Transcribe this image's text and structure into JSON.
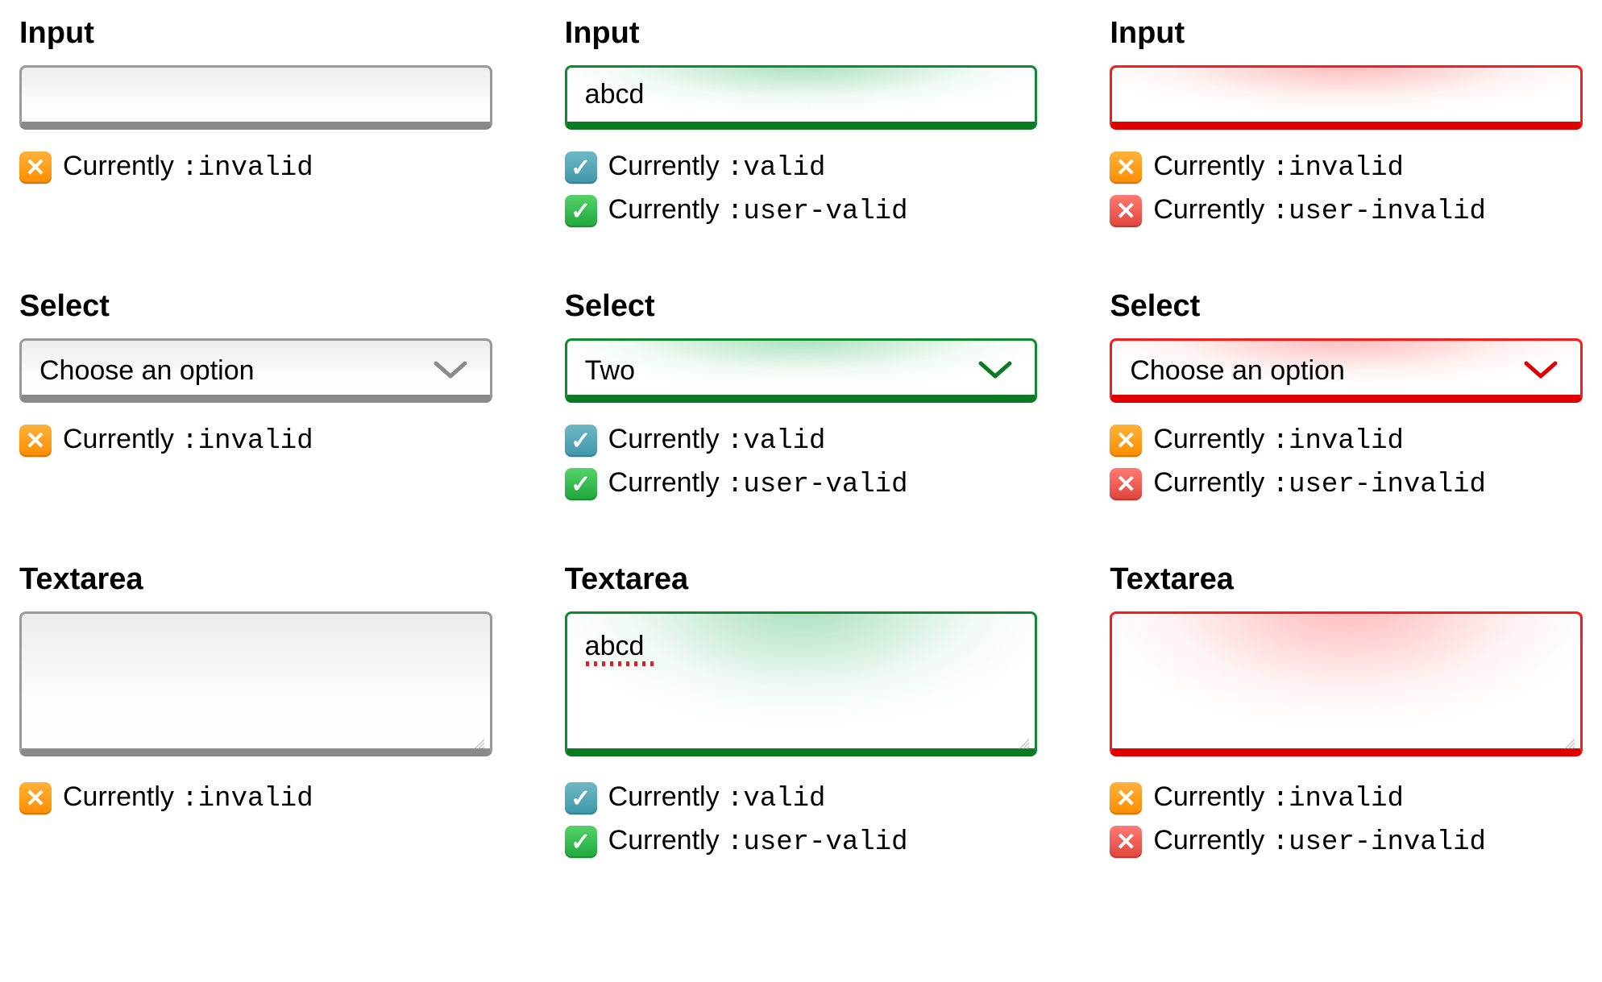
{
  "labels": {
    "input": "Input",
    "select": "Select",
    "textarea": "Textarea",
    "currently": "Currently "
  },
  "pseudo": {
    "invalid": ":invalid",
    "valid": ":valid",
    "user_valid": ":user-valid",
    "user_invalid": ":user-invalid"
  },
  "values": {
    "input_col1": "",
    "input_col2": "abcd",
    "input_col3": "",
    "select_col1": "Choose an option",
    "select_col2": "Two",
    "select_col3": "Choose an option",
    "textarea_col1": "",
    "textarea_col2": "abcd",
    "textarea_col3": ""
  },
  "colors": {
    "gray_border": "#9a9a9a",
    "green_border": "#0f8a2f",
    "red_border": "#ff1a1a"
  }
}
